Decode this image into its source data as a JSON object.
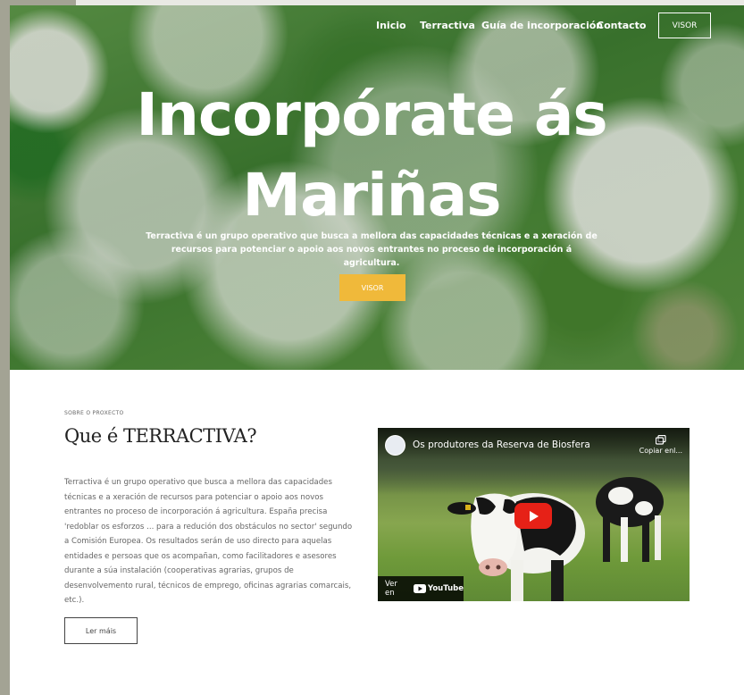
{
  "nav": {
    "links": [
      "Inicio",
      "Terractiva",
      "Guía de incorporación",
      "Contacto"
    ],
    "visor_label": "VISOR"
  },
  "hero": {
    "title_line1": "Incorpórate ás",
    "title_line2": "Mariñas",
    "subtitle": "Terractiva é un grupo operativo que busca a mellora das capacidades técnicas e a xeración de recursos para potenciar o apoio aos novos entrantes no proceso de incorporación á agricultura.",
    "button_label": "VISOR",
    "button_color": "#f0b93a"
  },
  "about": {
    "eyebrow": "SOBRE O PROXECTO",
    "title": "Que é TERRACTIVA?",
    "body": "Terractiva é un grupo operativo que busca a mellora das capacidades técnicas e a xeración de recursos para potenciar o apoio aos novos entrantes no proceso de incorporación á agricultura. España precisa 'redoblar os esforzos ... para a redución dos obstáculos no sector' segundo a Comisión Europea. Os resultados serán de uso directo para aquelas entidades e persoas que os acompañan, como facilitadores e asesores durante a súa instalación (cooperativas agrarias, grupos de desenvolvemento rural, técnicos de emprego, oficinas agrarias comarcais, etc.).",
    "more_label": "Ler máis"
  },
  "video": {
    "title": "Os produtores da Reserva de Biosfera",
    "copy_label": "Copiar enl...",
    "watch_on": "Ver en",
    "youtube_label": "YouTube",
    "play_icon": "play-icon"
  }
}
